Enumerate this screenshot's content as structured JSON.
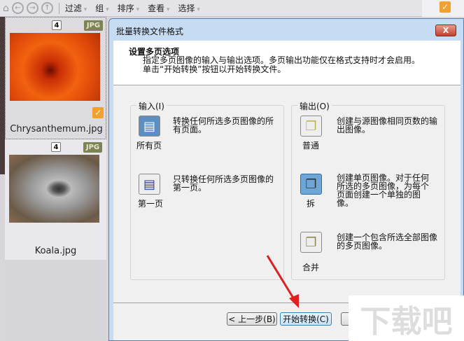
{
  "toolbar": {
    "menus": [
      "过滤",
      "组",
      "排序",
      "查看",
      "选择"
    ]
  },
  "files": [
    {
      "name": "Chrysanthemum.jpg",
      "pages": "4",
      "type": "JPG",
      "checked": true
    },
    {
      "name": "Koala.jpg",
      "pages": "4",
      "type": "JPG",
      "checked": false
    }
  ],
  "dialog": {
    "title": "批量转换文件格式",
    "close": "X",
    "heading": "设置多页选项",
    "description": "指定多页图像的输入与输出选项。多页输出功能仅在格式支持时才会启用。单击“开始转换”按钮以开始转换文件。",
    "input": {
      "legend": "输入(I)",
      "options": [
        {
          "label": "所有页",
          "desc": "转换任何所选多页图像的所有页面。"
        },
        {
          "label": "第一页",
          "desc": "只转换任何所选多页图像的第一页。"
        }
      ]
    },
    "output": {
      "legend": "输出(O)",
      "options": [
        {
          "label": "普通",
          "desc": "创建与源图像相同页数的输出图像。"
        },
        {
          "label": "拆",
          "desc": "创建单页图像。对于任何所选的多页图像，为每个页面创建一个单独的图像。"
        },
        {
          "label": "合并",
          "desc": "创建一个包含所选全部图像的多页图像。"
        }
      ]
    },
    "buttons": {
      "back": "< 上一步(B)",
      "start": "开始转换(C)"
    }
  },
  "watermark": "下载吧"
}
